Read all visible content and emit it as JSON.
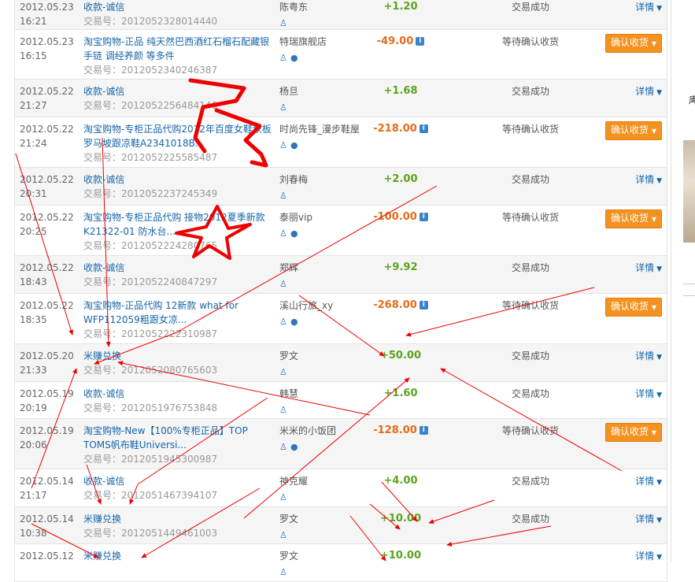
{
  "rows": [
    {
      "date": "2012.05.23",
      "time": "16:21",
      "title": "收款-诚信",
      "tradeno_label": "交易号：",
      "tradeno": "2012052328014440",
      "party": "陈粤东",
      "party_icons": false,
      "amount": "+1.20",
      "amount_sign": "pos",
      "amount_info": false,
      "status": "交易成功",
      "action": "详情"
    },
    {
      "date": "2012.05.23",
      "time": "16:15",
      "title": "淘宝购物-正品 纯天然巴西酒红石榴石配藏银手链 调经养颜 等多件",
      "tradeno_label": "交易号：",
      "tradeno": "2012052340246387",
      "party": "特瑞旗舰店",
      "party_icons": true,
      "amount": "-49.00",
      "amount_sign": "neg",
      "amount_info": true,
      "status": "等待确认收货",
      "action": "确认收货"
    },
    {
      "date": "2012.05.22",
      "time": "21:27",
      "title": "收款-诚信",
      "tradeno_label": "交易号：",
      "tradeno": "2012052256484146",
      "party": "杨旦",
      "party_icons": false,
      "amount": "+1.68",
      "amount_sign": "pos",
      "amount_info": false,
      "status": "交易成功",
      "action": "详情"
    },
    {
      "date": "2012.05.22",
      "time": "21:24",
      "title": "淘宝购物-专柜正品代购2012年百度女鞋秋板罗马坡跟凉鞋A2341018B...",
      "tradeno_label": "交易号：",
      "tradeno": "2012052225585487",
      "party": "时尚先锋_漫步鞋屋",
      "party_icons": true,
      "amount": "-218.00",
      "amount_sign": "neg",
      "amount_info": true,
      "status": "等待确认收货",
      "action": "确认收货"
    },
    {
      "date": "2012.05.22",
      "time": "20:31",
      "title": "收款-诚信",
      "tradeno_label": "交易号：",
      "tradeno": "2012052237245349",
      "party": "刘春梅",
      "party_icons": false,
      "amount": "+2.00",
      "amount_sign": "pos",
      "amount_info": false,
      "status": "交易成功",
      "action": "详情"
    },
    {
      "date": "2012.05.22",
      "time": "20:25",
      "title": "淘宝购物-专柜正品代购 接物2012夏季新款 K21322-01 防水台...",
      "tradeno_label": "交易号：",
      "tradeno": "2012052224280765",
      "party": "泰丽vip",
      "party_icons": true,
      "amount": "-100.00",
      "amount_sign": "neg",
      "amount_info": true,
      "status": "等待确认收货",
      "action": "确认收货"
    },
    {
      "date": "2012.05.22",
      "time": "18:43",
      "title": "收款-诚信",
      "tradeno_label": "交易号：",
      "tradeno": "2012052240847297",
      "party": "郑辉",
      "party_icons": false,
      "amount": "+9.92",
      "amount_sign": "pos",
      "amount_info": false,
      "status": "交易成功",
      "action": "详情"
    },
    {
      "date": "2012.05.22",
      "time": "18:35",
      "title": "淘宝购物-正品代购 12新款 what for WFP112059粗跟女凉...",
      "tradeno_label": "交易号：",
      "tradeno": "2012052222310987",
      "party": "溪山行旅_xy",
      "party_icons": true,
      "amount": "-268.00",
      "amount_sign": "neg",
      "amount_info": true,
      "status": "等待确认收货",
      "action": "确认收货"
    },
    {
      "date": "2012.05.20",
      "time": "21:33",
      "title": "米赚兑换",
      "tradeno_label": "交易号：",
      "tradeno": "2012052080765603",
      "party": "罗文",
      "party_icons": false,
      "amount": "+50.00",
      "amount_sign": "pos",
      "amount_info": false,
      "status": "交易成功",
      "action": "详情"
    },
    {
      "date": "2012.05.19",
      "time": "20:19",
      "title": "收款-诚信",
      "tradeno_label": "交易号：",
      "tradeno": "2012051976753848",
      "party": "韩慧",
      "party_icons": false,
      "amount": "+1.60",
      "amount_sign": "pos",
      "amount_info": false,
      "status": "交易成功",
      "action": "详情"
    },
    {
      "date": "2012.05.19",
      "time": "20:06",
      "title": "淘宝购物-New【100%专柜正品】TOP TOMS帆布鞋Universi...",
      "tradeno_label": "交易号：",
      "tradeno": "2012051945300987",
      "party": "米米的小饭团",
      "party_icons": true,
      "amount": "-128.00",
      "amount_sign": "neg",
      "amount_info": true,
      "status": "等待确认收货",
      "action": "确认收货"
    },
    {
      "date": "2012.05.14",
      "time": "21:17",
      "title": "收款-诚信",
      "tradeno_label": "交易号：",
      "tradeno": "2012051467394107",
      "party": "神克耀",
      "party_icons": false,
      "amount": "+4.00",
      "amount_sign": "pos",
      "amount_info": false,
      "status": "交易成功",
      "action": "详情"
    },
    {
      "date": "2012.05.14",
      "time": "10:38",
      "title": "米赚兑换",
      "tradeno_label": "交易号：",
      "tradeno": "2012051449461003",
      "party": "罗文",
      "party_icons": false,
      "amount": "+10.00",
      "amount_sign": "pos",
      "amount_info": false,
      "status": "交易成功",
      "action": "详情"
    },
    {
      "date": "2012.05.12",
      "time": "",
      "title": "米赚兑换",
      "tradeno_label": "",
      "tradeno": "",
      "party": "罗文",
      "party_icons": false,
      "amount": "+10.00",
      "amount_sign": "pos",
      "amount_info": false,
      "status": "",
      "action": "详情"
    }
  ],
  "info_icon_glyph": "i",
  "dropdown_glyph": "▼",
  "right_panel": {
    "text": "庳"
  }
}
